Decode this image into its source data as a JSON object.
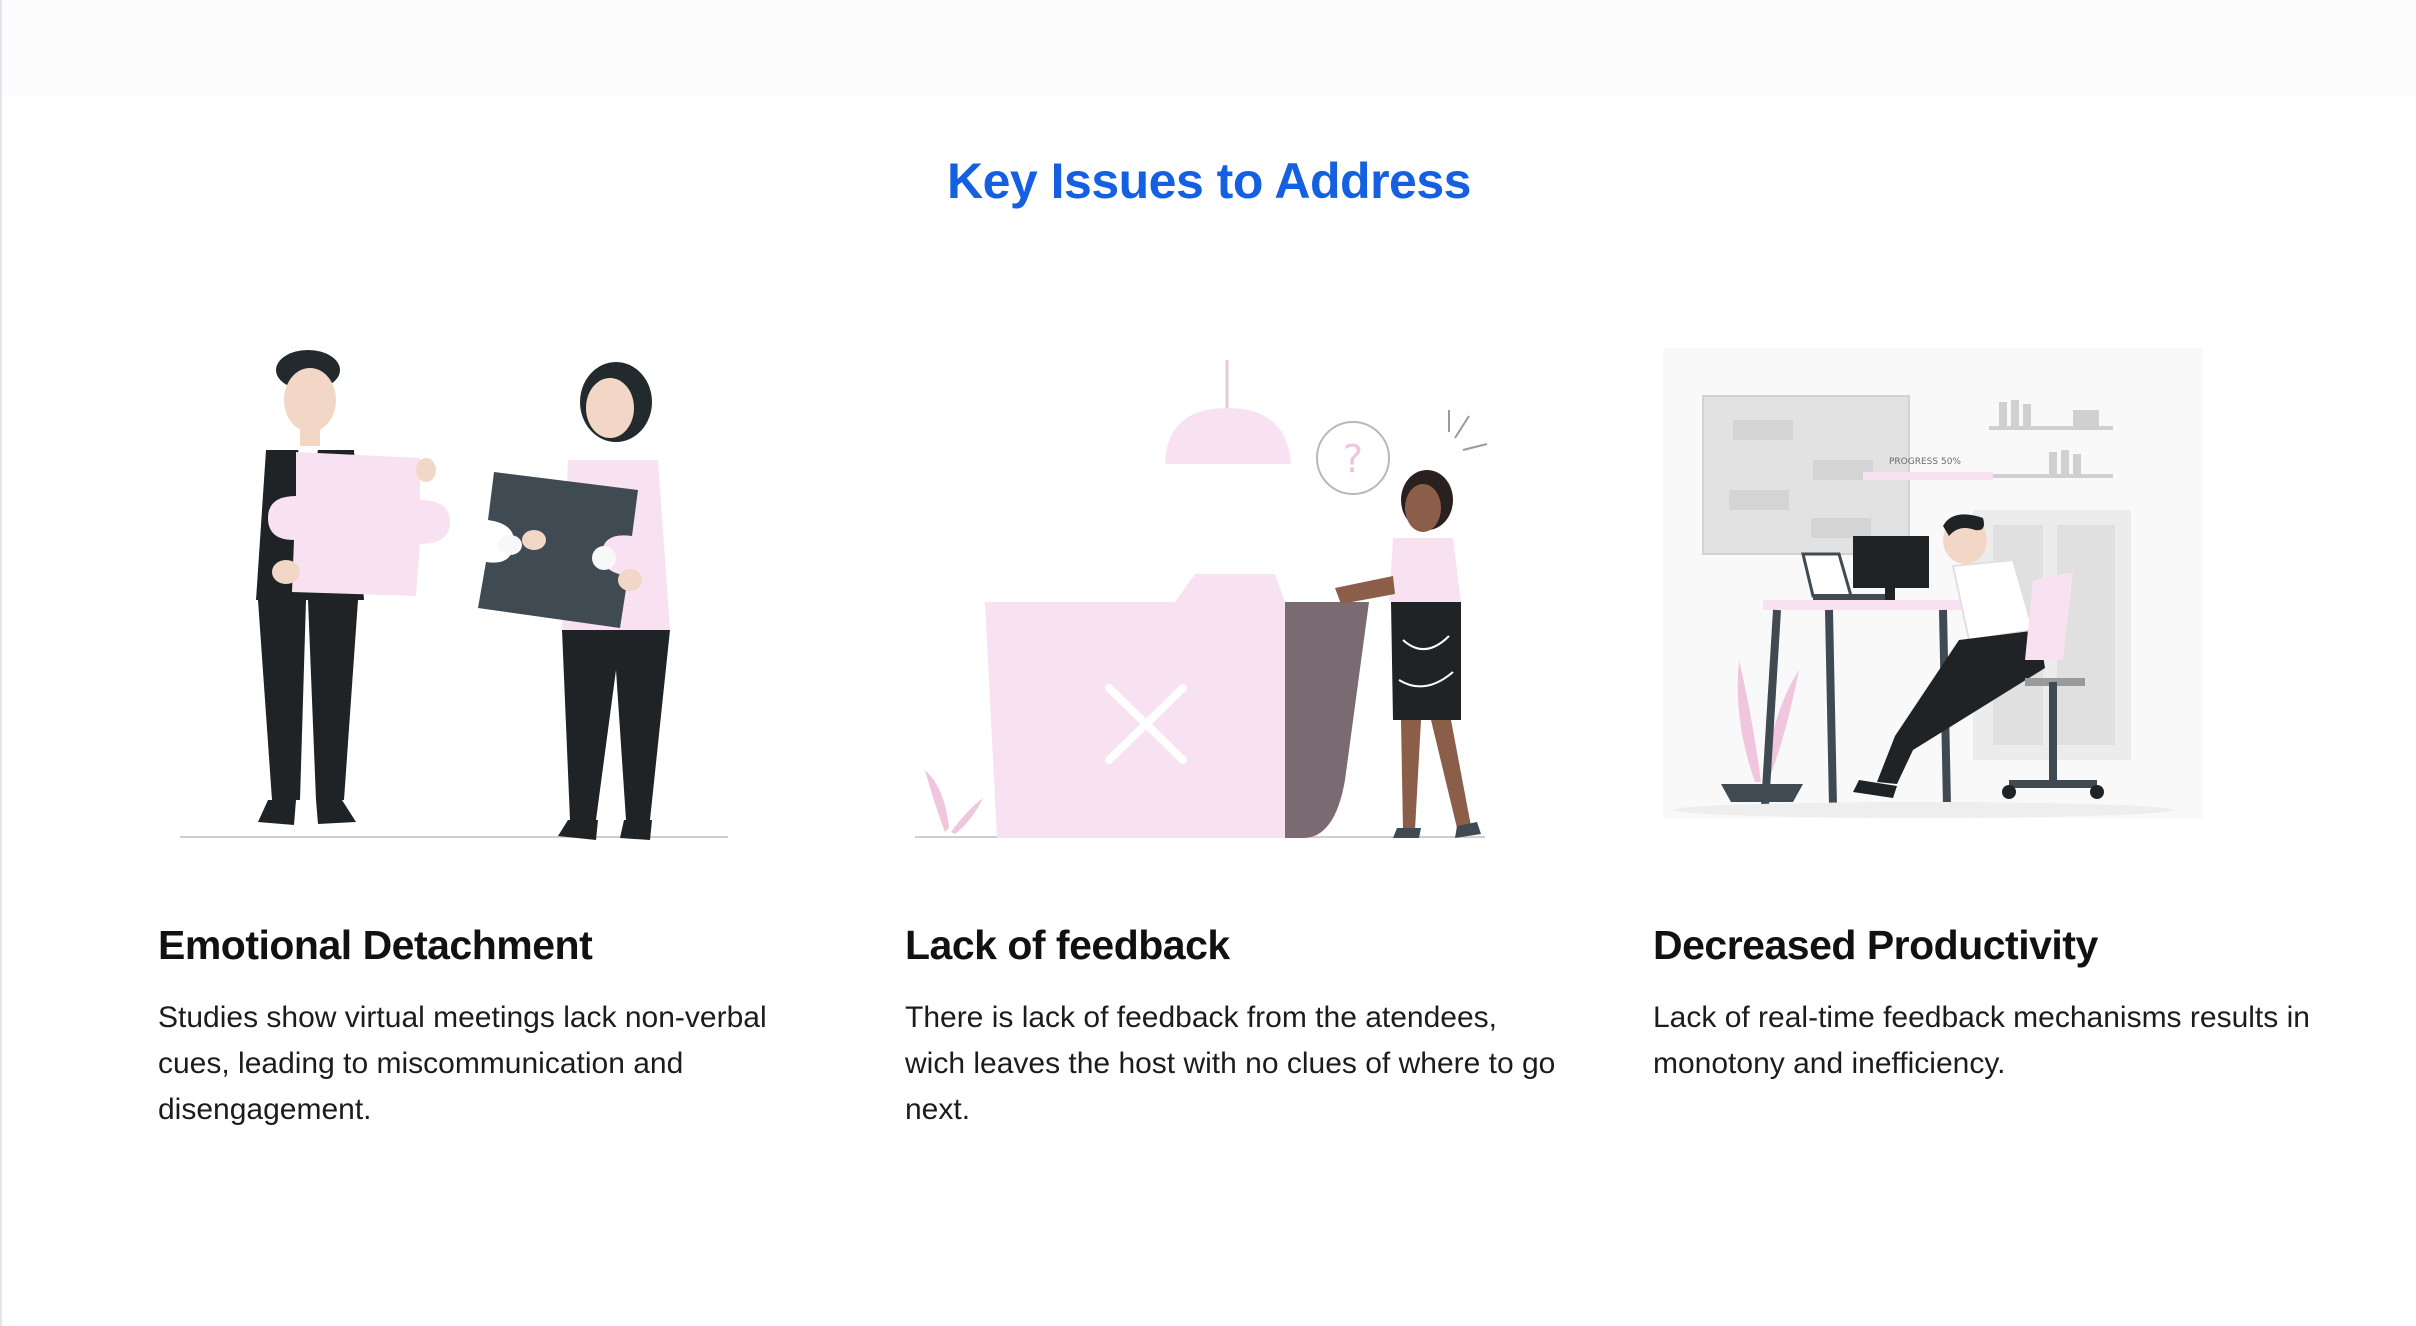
{
  "section": {
    "title": "Key Issues to Address"
  },
  "colors": {
    "title_blue": "#1560e0",
    "accent_pink": "#f8e1f1",
    "dark_slate": "#3f4a52",
    "text_dark": "#111111"
  },
  "cards": [
    {
      "illustration_icon": "puzzle-collaboration-illustration",
      "title": "Emotional Detachment",
      "text": "Studies show virtual meetings lack non-verbal cues, leading to miscommunication and disengagement."
    },
    {
      "illustration_icon": "confused-person-folder-illustration",
      "title": "Lack of feedback",
      "text": "There is lack of feedback from the atendees, wich leaves the host with no clues of where to go next."
    },
    {
      "illustration_icon": "desk-worker-illustration",
      "title": "Decreased Productivity",
      "text": "Lack of real-time feedback mechanisms results in monotony and inefficiency.",
      "illustration_label": "PROGRESS 50%"
    }
  ]
}
